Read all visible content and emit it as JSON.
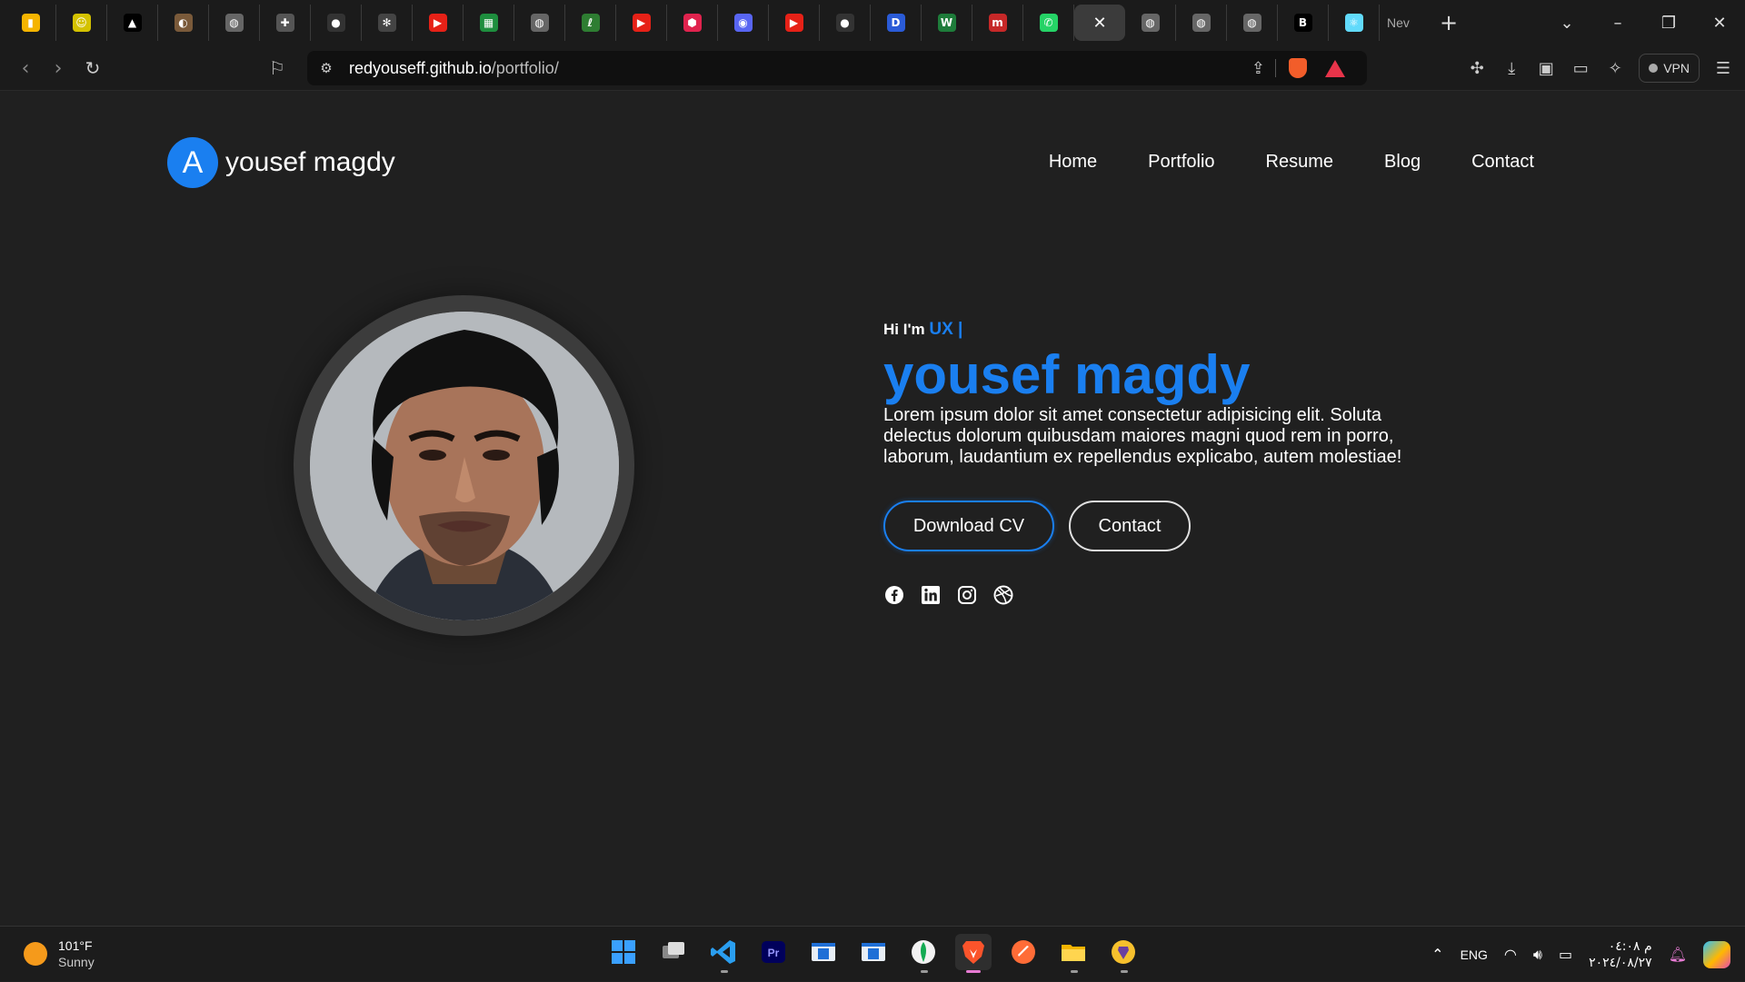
{
  "browser": {
    "tabs": [
      {
        "icon": "analytics-icon",
        "glyph": "▮",
        "color": "#f5b400"
      },
      {
        "icon": "emoji-icon",
        "glyph": "☺",
        "color": "#d4c200"
      },
      {
        "icon": "vercel-icon",
        "glyph": "▲",
        "color": "#000000"
      },
      {
        "icon": "brand-icon",
        "glyph": "◐",
        "color": "#7a5a3a"
      },
      {
        "icon": "globe-icon",
        "glyph": "◍",
        "color": "#666666"
      },
      {
        "icon": "puzzle-icon",
        "glyph": "✚",
        "color": "#555555"
      },
      {
        "icon": "github-icon",
        "glyph": "●",
        "color": "#333333"
      },
      {
        "icon": "openai-icon",
        "glyph": "✻",
        "color": "#444444"
      },
      {
        "icon": "youtube-icon",
        "glyph": "▶",
        "color": "#e62117"
      },
      {
        "icon": "sheet-icon",
        "glyph": "▦",
        "color": "#1e8e3e"
      },
      {
        "icon": "globe-icon",
        "glyph": "◍",
        "color": "#666666"
      },
      {
        "icon": "leaf-icon",
        "glyph": "ℓ",
        "color": "#2e7d32"
      },
      {
        "icon": "youtube-icon",
        "glyph": "▶",
        "color": "#e62117"
      },
      {
        "icon": "nest-icon",
        "glyph": "⬢",
        "color": "#e0234e"
      },
      {
        "icon": "discord-icon",
        "glyph": "◉",
        "color": "#5865f2"
      },
      {
        "icon": "youtube-icon",
        "glyph": "▶",
        "color": "#e62117"
      },
      {
        "icon": "github-icon",
        "glyph": "●",
        "color": "#333333"
      },
      {
        "icon": "d-icon",
        "glyph": "D",
        "color": "#2a5bd7"
      },
      {
        "icon": "w-icon",
        "glyph": "W",
        "color": "#1e7c3a"
      },
      {
        "icon": "m-icon",
        "glyph": "m",
        "color": "#c62828"
      },
      {
        "icon": "whatsapp-icon",
        "glyph": "✆",
        "color": "#25d366"
      },
      {
        "icon": "close-icon",
        "glyph": "✕",
        "color": "#3b3b3b",
        "active": true
      },
      {
        "icon": "globe-icon",
        "glyph": "◍",
        "color": "#666666"
      },
      {
        "icon": "globe-icon",
        "glyph": "◍",
        "color": "#666666"
      },
      {
        "icon": "globe-icon",
        "glyph": "◍",
        "color": "#666666"
      },
      {
        "icon": "bold-b-icon",
        "glyph": "B",
        "color": "#000000"
      },
      {
        "icon": "react-icon",
        "glyph": "⚛",
        "color": "#61dafb"
      }
    ],
    "new_tab_label": "Nev",
    "url_host": "redyouseff.github.io",
    "url_path": "/portfolio/",
    "vpn_label": "VPN"
  },
  "site": {
    "logo_letter": "A",
    "logo_name": "yousef magdy",
    "nav": [
      "Home",
      "Portfolio",
      "Resume",
      "Blog",
      "Contact"
    ],
    "greeting": "Hi I'm",
    "role": "UX |",
    "name": "yousef magdy",
    "description": "Lorem ipsum dolor sit amet consectetur adipisicing elit. Soluta delectus dolorum quibusdam maiores magni quod rem in porro, laborum, laudantium ex repellendus explicabo, autem molestiae!",
    "download_cv": "Download CV",
    "contact": "Contact",
    "socials": [
      "facebook-icon",
      "linkedin-icon",
      "instagram-icon",
      "dribbble-icon"
    ],
    "accent": "#1a7ff0"
  },
  "taskbar": {
    "temperature": "101°F",
    "condition": "Sunny",
    "language": "ENG",
    "time": "م ٠٤:٠٨",
    "date": "٢٠٢٤/٠٨/٢٧"
  }
}
